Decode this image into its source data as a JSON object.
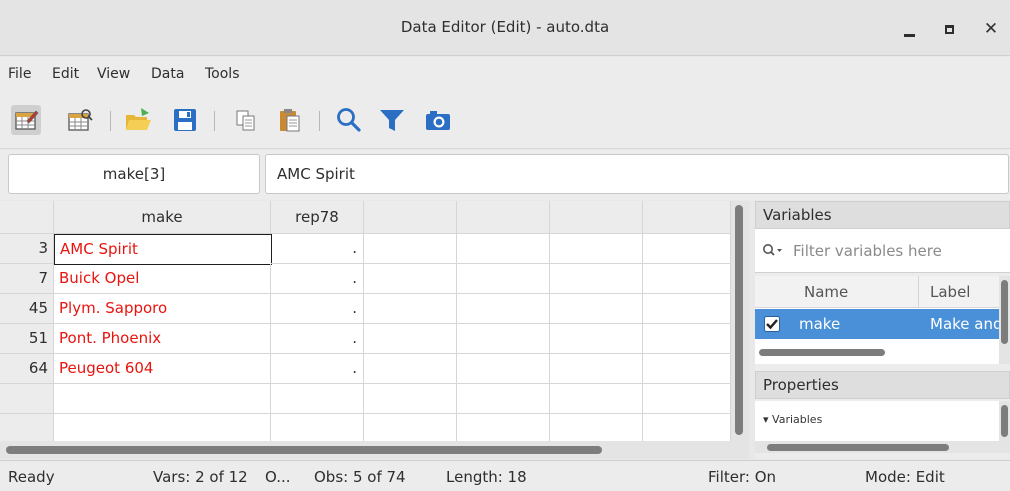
{
  "window": {
    "title": "Data Editor (Edit) - auto.dta"
  },
  "menu": [
    "File",
    "Edit",
    "View",
    "Data",
    "Tools"
  ],
  "toolbar": {
    "icons": [
      "edit-mode-icon",
      "browse-mode-icon",
      "open-icon",
      "save-icon",
      "copy-icon",
      "paste-icon",
      "find-icon",
      "filter-icon",
      "snapshot-icon"
    ]
  },
  "cell_editor": {
    "name": "make[3]",
    "value": "AMC Spirit"
  },
  "grid": {
    "columns": [
      "make",
      "rep78",
      "",
      "",
      "",
      ""
    ],
    "rows": [
      {
        "obs": "3",
        "make": "AMC Spirit",
        "rep78": "."
      },
      {
        "obs": "7",
        "make": "Buick Opel",
        "rep78": "."
      },
      {
        "obs": "45",
        "make": "Plym. Sapporo",
        "rep78": "."
      },
      {
        "obs": "51",
        "make": "Pont. Phoenix",
        "rep78": "."
      },
      {
        "obs": "64",
        "make": "Peugeot 604",
        "rep78": "."
      }
    ]
  },
  "variables_panel": {
    "title": "Variables",
    "filter_placeholder": "Filter variables here",
    "col_name": "Name",
    "col_label": "Label",
    "row": {
      "name": "make",
      "label": "Make and Model",
      "checked": true
    }
  },
  "properties_panel": {
    "title": "Properties",
    "section": "Variables"
  },
  "status": {
    "state": "Ready",
    "vars": "Vars: 2 of 12",
    "order": "O...",
    "obs": "Obs: 5 of 74",
    "length": "Length: 18",
    "filter": "Filter: On",
    "mode": "Mode: Edit"
  },
  "colors": {
    "string_text": "#e8140f",
    "selection": "#4a90d9"
  }
}
